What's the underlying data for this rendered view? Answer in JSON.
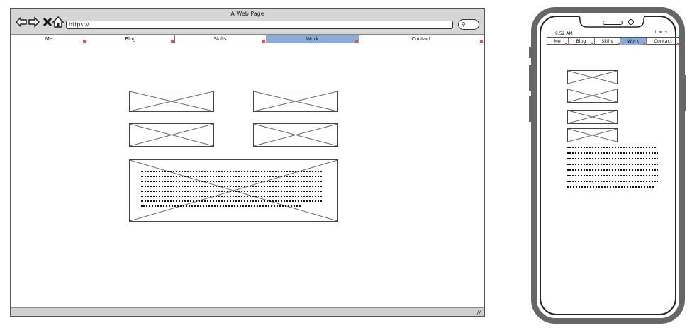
{
  "desktop": {
    "window_title": "A Web Page",
    "url": "https://",
    "search_icon": "search-icon",
    "nav_items": [
      {
        "label": "Me",
        "active": false
      },
      {
        "label": "Blog",
        "active": false
      },
      {
        "label": "Skills",
        "active": false
      },
      {
        "label": "Work",
        "active": true
      },
      {
        "label": "Contact",
        "active": false
      }
    ]
  },
  "phone": {
    "time": "9:52 AM",
    "status_icons": "..il ≈ ▭",
    "nav_items": [
      {
        "label": "Me",
        "active": false
      },
      {
        "label": "Blog",
        "active": false
      },
      {
        "label": "Skills",
        "active": false
      },
      {
        "label": "Work",
        "active": true
      },
      {
        "label": "Contact",
        "active": false
      }
    ]
  },
  "colors": {
    "active_tab": "#8aabd9",
    "marker": "#e05050",
    "chrome": "#d6d6d6"
  }
}
